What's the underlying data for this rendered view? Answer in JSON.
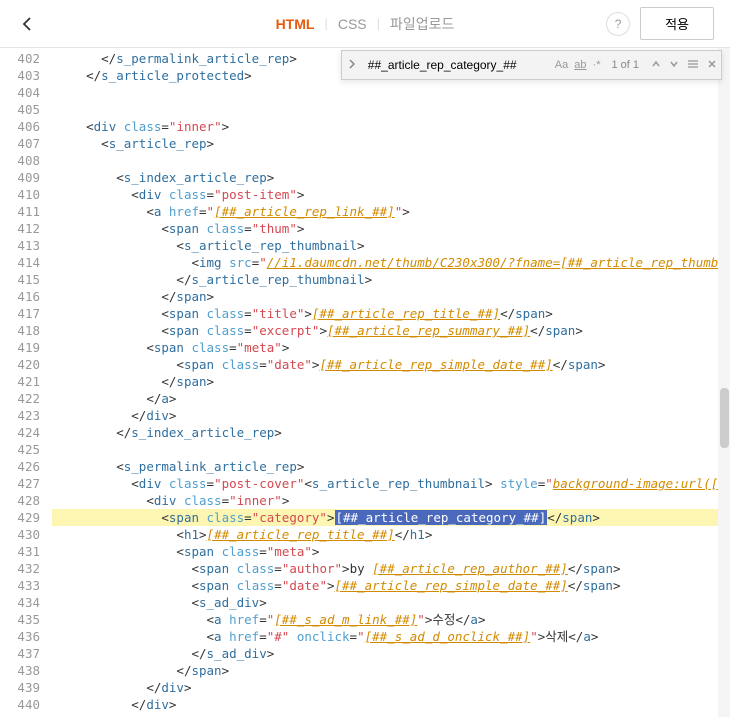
{
  "header": {
    "tabs": {
      "html": "HTML",
      "css": "CSS",
      "upload": "파일업로드"
    },
    "help": "?",
    "apply": "적용"
  },
  "find": {
    "value": "##_article_rep_category_##",
    "aa": "Aa",
    "ab": "ab",
    "star": "*",
    "count": "1 of 1"
  },
  "lines": {
    "start": 402,
    "end": 440
  },
  "code": {
    "l402": {
      "i": 6,
      "a": "</",
      "b": "s_permalink_article_rep",
      "c": ">"
    },
    "l403": {
      "i": 4,
      "a": "</",
      "b": "s_article_protected",
      "c": ">"
    },
    "l404": {
      "i": 0
    },
    "l405": {
      "i": 0
    },
    "l406": {
      "i": 4,
      "a": "<",
      "b": "div",
      "sp": " ",
      "at": "class",
      "eq": "=",
      "v": "\"inner\"",
      "c": ">"
    },
    "l407": {
      "i": 6,
      "a": "<",
      "b": "s_article_rep",
      "c": ">"
    },
    "l408": {
      "i": 0
    },
    "l409": {
      "i": 8,
      "a": "<",
      "b": "s_index_article_rep",
      "c": ">"
    },
    "l410": {
      "i": 10,
      "a": "<",
      "b": "div",
      "sp": " ",
      "at": "class",
      "eq": "=",
      "v": "\"post-item\"",
      "c": ">"
    },
    "l411": {
      "i": 12,
      "a": "<",
      "b": "a",
      "sp": " ",
      "at": "href",
      "eq": "=",
      "q": "\"",
      "lk": "[##_article_rep_link_##]",
      "q2": "\"",
      "c": ">"
    },
    "l412": {
      "i": 14,
      "a": "<",
      "b": "span",
      "sp": " ",
      "at": "class",
      "eq": "=",
      "v": "\"thum\"",
      "c": ">"
    },
    "l413": {
      "i": 16,
      "a": "<",
      "b": "s_article_rep_thumbnail",
      "c": ">"
    },
    "l414": {
      "i": 18,
      "a": "<",
      "b": "img",
      "sp": " ",
      "at": "src",
      "eq": "=",
      "q": "\"",
      "lk": "//i1.daumcdn.net/thumb/C230x300/?fname=",
      "lk2": "[##_article_rep_thumbnail_raw_"
    },
    "l415": {
      "i": 16,
      "a": "</",
      "b": "s_article_rep_thumbnail",
      "c": ">"
    },
    "l416": {
      "i": 14,
      "a": "</",
      "b": "span",
      "c": ">"
    },
    "l417": {
      "i": 14,
      "a": "<",
      "b": "span",
      "sp": " ",
      "at": "class",
      "eq": "=",
      "v": "\"title\"",
      "c": ">",
      "lk": "[##_article_rep_title_##]",
      "a2": "</",
      "b2": "span",
      "c2": ">"
    },
    "l418": {
      "i": 14,
      "a": "<",
      "b": "span",
      "sp": " ",
      "at": "class",
      "eq": "=",
      "v": "\"excerpt\"",
      "c": ">",
      "lk": "[##_article_rep_summary_##]",
      "a2": "</",
      "b2": "span",
      "c2": ">"
    },
    "l419": {
      "i": 12,
      "a": "<",
      "b": "span",
      "sp": " ",
      "at": "class",
      "eq": "=",
      "v": "\"meta\"",
      "c": ">"
    },
    "l420": {
      "i": 16,
      "a": "<",
      "b": "span",
      "sp": " ",
      "at": "class",
      "eq": "=",
      "v": "\"date\"",
      "c": ">",
      "lk": "[##_article_rep_simple_date_##]",
      "a2": "</",
      "b2": "span",
      "c2": ">"
    },
    "l421": {
      "i": 14,
      "a": "</",
      "b": "span",
      "c": ">"
    },
    "l422": {
      "i": 12,
      "a": "</",
      "b": "a",
      "c": ">"
    },
    "l423": {
      "i": 10,
      "a": "</",
      "b": "div",
      "c": ">"
    },
    "l424": {
      "i": 8,
      "a": "</",
      "b": "s_index_article_rep",
      "c": ">"
    },
    "l425": {
      "i": 0
    },
    "l426": {
      "i": 8,
      "a": "<",
      "b": "s_permalink_article_rep",
      "c": ">"
    },
    "l427": {
      "i": 10,
      "a": "<",
      "b": "div",
      "sp": " ",
      "at": "class",
      "eq": "=",
      "v": "\"post-cover\"",
      "mid": "<",
      "mb": "s_article_rep_thumbnail",
      "mc": "> ",
      "at2": "style",
      "eq2": "=",
      "q": "\"",
      "lk": "background-image:url(",
      "lk2": "[##_articl"
    },
    "l428": {
      "i": 12,
      "a": "<",
      "b": "div",
      "sp": " ",
      "at": "class",
      "eq": "=",
      "v": "\"inner\"",
      "c": ">"
    },
    "l429": {
      "i": 14,
      "a": "<",
      "b": "span",
      "sp": " ",
      "at": "class",
      "eq": "=",
      "v": "\"category\"",
      "c": ">",
      "sel": "[##_article_rep_category_##]",
      "a2": "</",
      "b2": "span",
      "c2": ">"
    },
    "l430": {
      "i": 16,
      "a": "<",
      "b": "h1",
      "c": ">",
      "lk": "[##_article_rep_title_##]",
      "a2": "</",
      "b2": "h1",
      "c2": ">"
    },
    "l431": {
      "i": 16,
      "a": "<",
      "b": "span",
      "sp": " ",
      "at": "class",
      "eq": "=",
      "v": "\"meta\"",
      "c": ">"
    },
    "l432": {
      "i": 18,
      "a": "<",
      "b": "span",
      "sp": " ",
      "at": "class",
      "eq": "=",
      "v": "\"author\"",
      "c": ">",
      "txt": "by ",
      "lk": "[##_article_rep_author_##]",
      "a2": "</",
      "b2": "span",
      "c2": ">"
    },
    "l433": {
      "i": 18,
      "a": "<",
      "b": "span",
      "sp": " ",
      "at": "class",
      "eq": "=",
      "v": "\"date\"",
      "c": ">",
      "lk": "[##_article_rep_simple_date_##]",
      "a2": "</",
      "b2": "span",
      "c2": ">"
    },
    "l434": {
      "i": 18,
      "a": "<",
      "b": "s_ad_div",
      "c": ">"
    },
    "l435": {
      "i": 20,
      "a": "<",
      "b": "a",
      "sp": " ",
      "at": "href",
      "eq": "=",
      "q": "\"",
      "lk": "[##_s_ad_m_link_##]",
      "q2": "\"",
      "c": ">",
      "txt": "수정",
      "a2": "</",
      "b2": "a",
      "c2": ">"
    },
    "l436": {
      "i": 20,
      "a": "<",
      "b": "a",
      "sp": " ",
      "at": "href",
      "eq": "=",
      "v": "\"#\"",
      "sp2": " ",
      "at2": "onclick",
      "eq2": "=",
      "q": "\"",
      "lk": "[##_s_ad_d_onclick_##]",
      "q2": "\"",
      "c": ">",
      "txt": "삭제",
      "a2": "</",
      "b2": "a",
      "c2": ">"
    },
    "l437": {
      "i": 18,
      "a": "</",
      "b": "s_ad_div",
      "c": ">"
    },
    "l438": {
      "i": 16,
      "a": "</",
      "b": "span",
      "c": ">"
    },
    "l439": {
      "i": 12,
      "a": "</",
      "b": "div",
      "c": ">"
    },
    "l440": {
      "i": 10,
      "a": "</",
      "b": "div",
      "c": ">"
    }
  }
}
